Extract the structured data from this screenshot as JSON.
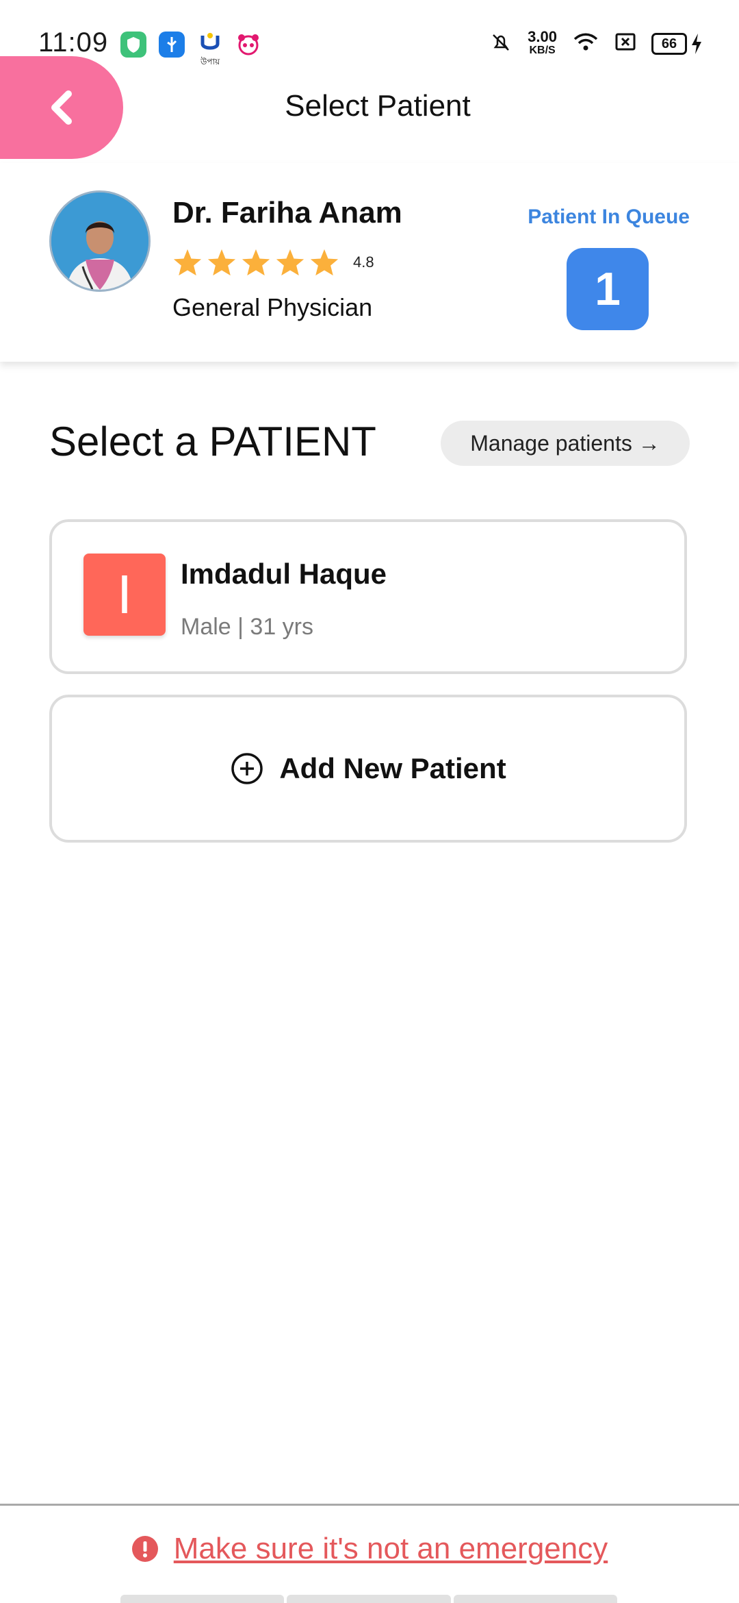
{
  "status_bar": {
    "time": "11:09",
    "upay_label": "উপায়",
    "net_speed_value": "3.00",
    "net_speed_unit": "KB/S",
    "battery_level": "66"
  },
  "header": {
    "title": "Select Patient",
    "back_icon": "chevron-left-icon",
    "back_color": "#f8709e"
  },
  "doctor": {
    "name": "Dr. Fariha Anam",
    "rating_value": "4.8",
    "rating_stars": 5,
    "specialty": "General Physician",
    "queue_label": "Patient In Queue",
    "queue_count": "1",
    "queue_color": "#3f87ea"
  },
  "section": {
    "title": "Select a PATIENT",
    "manage_label": "Manage patients →"
  },
  "patients": [
    {
      "initial": "I",
      "name": "Imdadul Haque",
      "meta": "Male | 31 yrs",
      "color": "#ff6759"
    }
  ],
  "add_patient": {
    "label": "Add New Patient",
    "icon": "plus-circle-icon"
  },
  "footer": {
    "emergency_text": "Make sure it's not an emergency",
    "emergency_icon": "alert-circle-icon",
    "emergency_color": "#e4585b"
  }
}
